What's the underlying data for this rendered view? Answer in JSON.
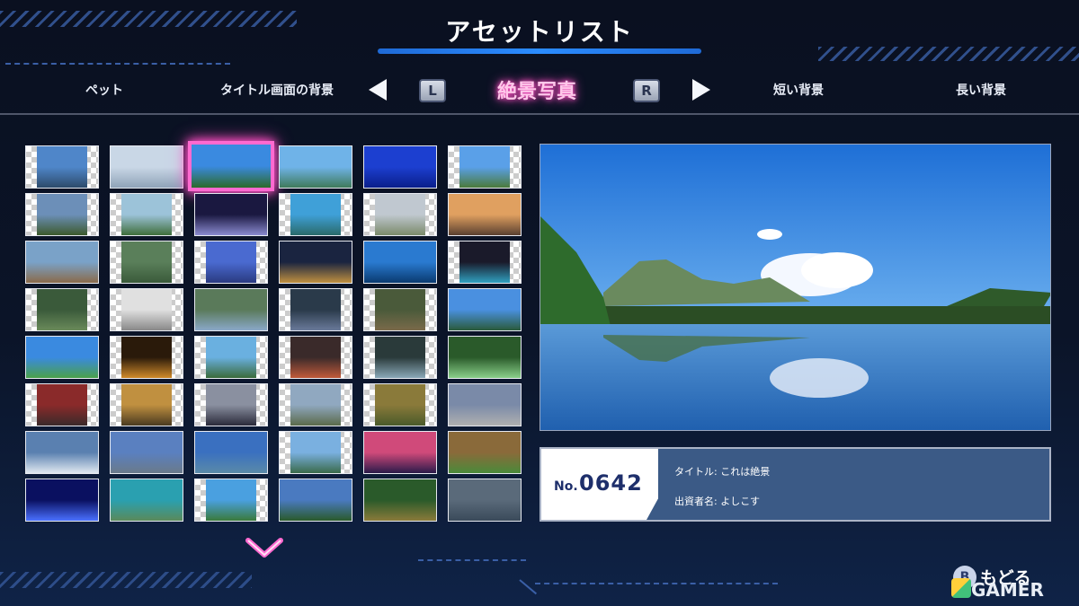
{
  "header": {
    "title": "アセットリスト"
  },
  "tabs": {
    "pet": "ペット",
    "title_bg": "タイトル画面の背景",
    "active": "絶景写真",
    "short_bg": "短い背景",
    "long_bg": "長い背景",
    "key_left": "L",
    "key_right": "R"
  },
  "selected": {
    "row": 0,
    "col": 2
  },
  "thumbnails": [
    [
      "landscape-fuji",
      "sky-haze",
      "lake-reflection",
      "coast-pier",
      "blue-bokeh",
      "hill-clouds"
    ],
    [
      "mountain-valley",
      "green-bay",
      "night-spotlight",
      "island-sea",
      "castle",
      "sunset-clouds"
    ],
    [
      "rocky-shore",
      "green-hill",
      "blue-flowers",
      "city-night",
      "sea-rocks",
      "night-ship"
    ],
    [
      "forest-aquarium",
      "sign-board",
      "town-view",
      "dark-foliage",
      "forest-path",
      "mountain-ridge"
    ],
    [
      "meadow-sky",
      "lanterns",
      "person-coast",
      "food-bowl",
      "tree-silhouette",
      "waterfall-green"
    ],
    [
      "shrine-red",
      "autumn-tree",
      "dusk-lake",
      "tree-sky",
      "field-trees",
      "snow-mountain"
    ],
    [
      "waterfall-cliff",
      "alpine-range",
      "lake-mountains",
      "lake-grass",
      "pink-sunset",
      "ruins"
    ],
    [
      "blue-lights",
      "beach-aerial",
      "palm-coast",
      "green-volcano",
      "tall-forest",
      "misty-mountain"
    ]
  ],
  "info": {
    "no_label": "No.",
    "number": "0642",
    "title_line": "タイトル: これは絶景",
    "author_line": "出資者名: よしこす"
  },
  "footer": {
    "b_key": "B",
    "back_label": "もどる",
    "watermark": "GAMER"
  },
  "colors": {
    "accent_pink": "#ff4fc4",
    "accent_blue": "#2b8cff",
    "info_bg": "#3b5a86"
  }
}
